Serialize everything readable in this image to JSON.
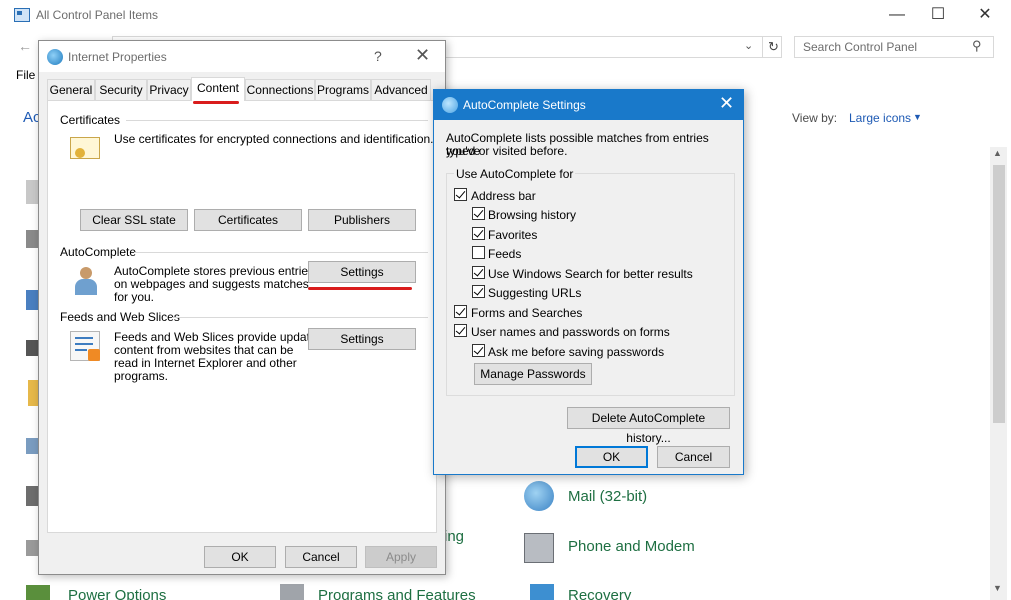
{
  "control_panel": {
    "title": "All Control Panel Items",
    "minimize": "—",
    "maximize": "☐",
    "close": "✕",
    "back_arrow": "←",
    "refresh": "↻",
    "search_placeholder": "Search Control Panel",
    "menu_file": "File",
    "heading_partial": "Ac",
    "view_by_label": "View by:",
    "view_by_value": "Large icons",
    "items": [
      {
        "label": "Mail (32-bit)"
      },
      {
        "label": "Phone and Modem"
      },
      {
        "label": "Power Options"
      },
      {
        "label": "Programs and Features"
      },
      {
        "label": "Recovery"
      }
    ],
    "partial_text_ing": "ing"
  },
  "internet_properties": {
    "title": "Internet Properties",
    "help": "?",
    "close": "✕",
    "tabs": [
      {
        "label": "General"
      },
      {
        "label": "Security"
      },
      {
        "label": "Privacy"
      },
      {
        "label": "Content"
      },
      {
        "label": "Connections"
      },
      {
        "label": "Programs"
      },
      {
        "label": "Advanced"
      }
    ],
    "selected_tab": "Content",
    "certificates": {
      "label": "Certificates",
      "description": "Use certificates for encrypted connections and identification.",
      "buttons": [
        "Clear SSL state",
        "Certificates",
        "Publishers"
      ]
    },
    "autocomplete": {
      "label": "AutoComplete",
      "description_lines": [
        "AutoComplete stores previous entries",
        "on webpages and suggests matches",
        "for you."
      ],
      "settings_button": "Settings"
    },
    "feeds": {
      "label": "Feeds and Web Slices",
      "description_lines": [
        "Feeds and Web Slices provide updated",
        "content from websites that can be",
        "read in Internet Explorer and other",
        "programs."
      ],
      "settings_button": "Settings"
    },
    "footer": {
      "ok": "OK",
      "cancel": "Cancel",
      "apply": "Apply"
    }
  },
  "autocomplete_settings": {
    "title": "AutoComplete Settings",
    "close": "✕",
    "description_lines": [
      "AutoComplete lists possible matches from entries you've",
      "typed or visited before."
    ],
    "group_label": "Use AutoComplete for",
    "options": [
      {
        "label": "Address bar",
        "checked": true
      },
      {
        "label": "Browsing history",
        "checked": true
      },
      {
        "label": "Favorites",
        "checked": true
      },
      {
        "label": "Feeds",
        "checked": false
      },
      {
        "label": "Use Windows Search for better results",
        "checked": true
      },
      {
        "label": "Suggesting URLs",
        "checked": true
      },
      {
        "label": "Forms and Searches",
        "checked": true
      },
      {
        "label": "User names and passwords on forms",
        "checked": true
      },
      {
        "label": "Ask me before saving passwords",
        "checked": true
      }
    ],
    "manage_passwords": "Manage Passwords",
    "delete_history": "Delete AutoComplete history...",
    "ok": "OK",
    "cancel": "Cancel"
  },
  "colors": {
    "accent_blue": "#1979ca",
    "link_green": "#1e6f42",
    "annotation_red": "#d91c1c"
  }
}
